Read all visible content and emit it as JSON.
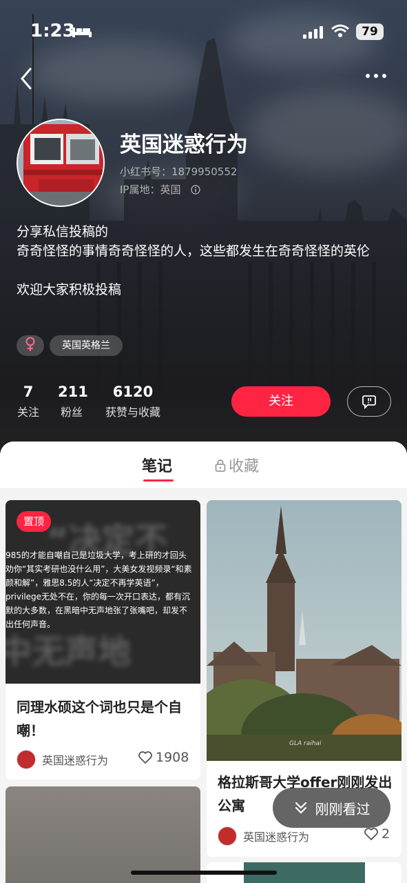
{
  "status_bar": {
    "time": "1:23",
    "battery": "79"
  },
  "profile": {
    "name": "英国迷惑行为",
    "id_line": "小红书号：1879950552",
    "ip_line": "IP属地：英国",
    "bio": [
      "分享私信投稿的",
      "奇奇怪怪的事情奇奇怪怪的人，这些都发生在奇奇怪怪的英伦",
      "",
      "欢迎大家积极投稿"
    ],
    "gender_icon": "female-icon",
    "tag": "英国英格兰"
  },
  "stats": [
    {
      "value": "7",
      "label": "关注"
    },
    {
      "value": "211",
      "label": "粉丝"
    },
    {
      "value": "6120",
      "label": "获赞与收藏"
    }
  ],
  "follow_label": "关注",
  "tabs": {
    "notes": "笔记",
    "favorites": "收藏"
  },
  "posts": [
    {
      "pinned_label": "置顶",
      "image_text": [
        "985的才能自嘲自己是垃圾大学，考上研的才回头",
        "劝你“其实考研也没什么用”，大美女发视频录“和素",
        "颜和解”，雅思8.5的人“决定不再学英语”，",
        "privilege无处不在，你的每一次开口表达，都有沉",
        "默的大多数，在黑暗中无声地张了张嘴吧，却发不",
        "出任何声音。"
      ],
      "title": "同理水硕这个词也只是个自嘲！",
      "author": "英国迷惑行为",
      "likes": "1908"
    },
    {
      "image_signature": "GLA raihai",
      "title": "格拉斯哥大学offer刚刚发出公寓",
      "author": "英国迷惑行为",
      "likes": "2"
    }
  ],
  "floating_button": "刚刚看过",
  "colors": {
    "accent": "#ff2442"
  }
}
